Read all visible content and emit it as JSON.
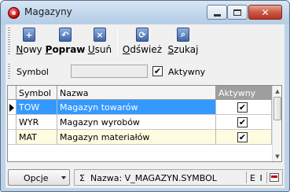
{
  "window": {
    "title": "Magazyny"
  },
  "toolbar": {
    "buttons": [
      {
        "key": "N",
        "rest": "owy",
        "icon": "+"
      },
      {
        "key": "P",
        "rest": "opraw",
        "icon": "↶"
      },
      {
        "key": "U",
        "rest": "suń",
        "icon": "×"
      },
      {
        "key": "O",
        "rest": "dśwież",
        "icon": "⟳"
      },
      {
        "key": "S",
        "rest": "zukaj",
        "icon": "⌕"
      }
    ]
  },
  "filter": {
    "symbol_label": "Symbol",
    "symbol_value": "",
    "aktywny_label": "Aktywny",
    "aktywny_checked": "✔"
  },
  "grid": {
    "columns": [
      "Symbol",
      "Nazwa",
      "Aktywny"
    ],
    "rows": [
      {
        "symbol": "TOW",
        "nazwa": "Magazyn towarów",
        "aktywny": "✔"
      },
      {
        "symbol": "WYR",
        "nazwa": "Magazyn wyrobów",
        "aktywny": "✔"
      },
      {
        "symbol": "MAT",
        "nazwa": "Magazyn materiałów",
        "aktywny": "✔"
      }
    ]
  },
  "statusbar": {
    "options_label": "Opcje",
    "sigma": "Σ",
    "text": "Nazwa: V_MAGAZYN.SYMBOL",
    "ei": "E I"
  }
}
